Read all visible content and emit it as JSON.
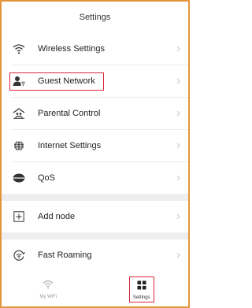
{
  "header": {
    "title": "Settings"
  },
  "menu": [
    {
      "label": "Wireless Settings",
      "icon": "wifi-icon"
    },
    {
      "label": "Guest Network",
      "icon": "guest-user-icon"
    },
    {
      "label": "Parental Control",
      "icon": "parental-control-icon"
    },
    {
      "label": "Internet Settings",
      "icon": "globe-icon"
    },
    {
      "label": "QoS",
      "icon": "qos-icon"
    }
  ],
  "menu2": [
    {
      "label": "Add node",
      "icon": "add-node-icon"
    }
  ],
  "menu3": [
    {
      "label": "Fast Roaming",
      "icon": "fast-roaming-icon"
    }
  ],
  "tabs": [
    {
      "label": "My WiFi",
      "icon": "wifi-icon"
    },
    {
      "label": "Settings",
      "icon": "grid-icon"
    }
  ],
  "colors": {
    "frame_border": "#e4953c",
    "highlight": "#d9263a",
    "text": "#222222",
    "muted": "#999999",
    "divider_band": "#eeeeee"
  }
}
